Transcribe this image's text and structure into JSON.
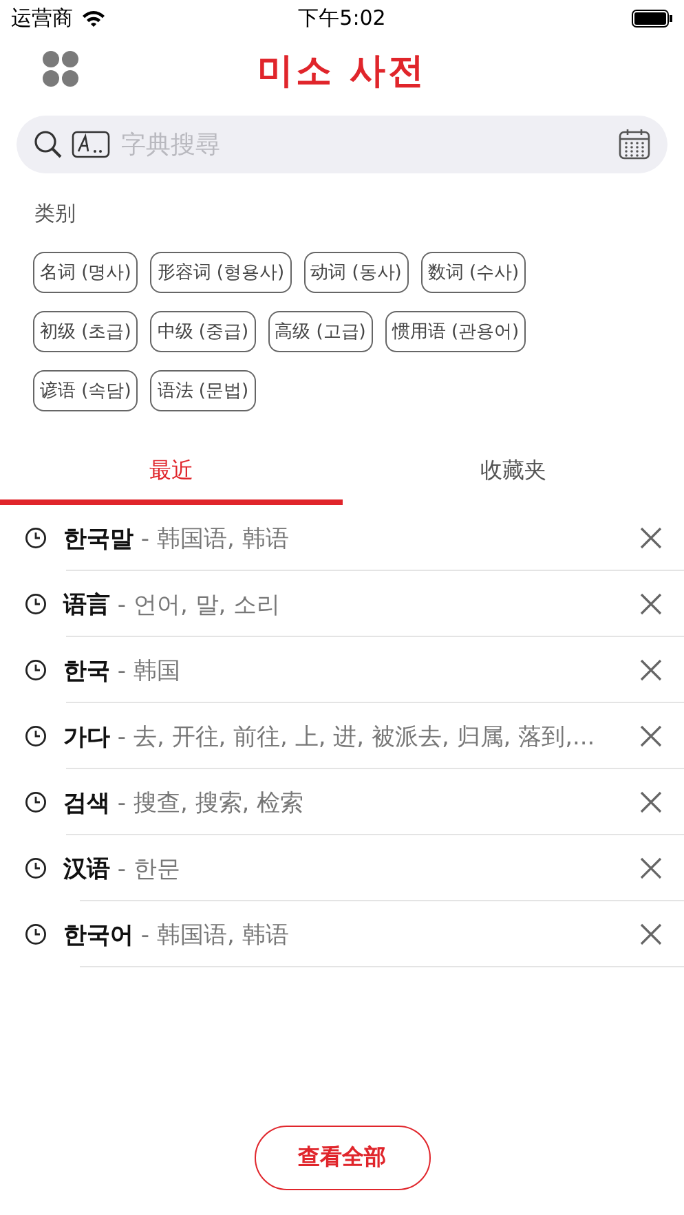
{
  "status_bar": {
    "carrier": "运营商",
    "time": "下午5:02"
  },
  "header": {
    "title": "미소 사전"
  },
  "search": {
    "placeholder": "字典搜尋"
  },
  "categories": {
    "title": "类别",
    "items": [
      {
        "label": "名词 (명사)"
      },
      {
        "label": "形容词 (형용사)"
      },
      {
        "label": "动词 (동사)"
      },
      {
        "label": "数词 (수사)"
      },
      {
        "label": "初级 (초급)"
      },
      {
        "label": "中级 (중급)"
      },
      {
        "label": "高级 (고급)"
      },
      {
        "label": "惯用语 (관용어)"
      },
      {
        "label": "谚语 (속담)"
      },
      {
        "label": "语法 (문법)"
      }
    ]
  },
  "tabs": [
    {
      "label": "最近",
      "selected": true
    },
    {
      "label": "收藏夹",
      "selected": false
    }
  ],
  "history": [
    {
      "word": "한국말",
      "meaning": "- 韩国语, 韩语"
    },
    {
      "word": "语言",
      "meaning": "- 언어, 말, 소리"
    },
    {
      "word": "한국",
      "meaning": "- 韩国"
    },
    {
      "word": "가다",
      "meaning": "- 去, 开往, 前往, 上, 进, 被派去, 归属, 落到,..."
    },
    {
      "word": "검색",
      "meaning": "- 搜查, 搜索, 检索"
    },
    {
      "word": "汉语",
      "meaning": "- 한문"
    },
    {
      "word": "한국어",
      "meaning": "- 韩国语, 韩语"
    }
  ],
  "view_all_button": "查看全部"
}
